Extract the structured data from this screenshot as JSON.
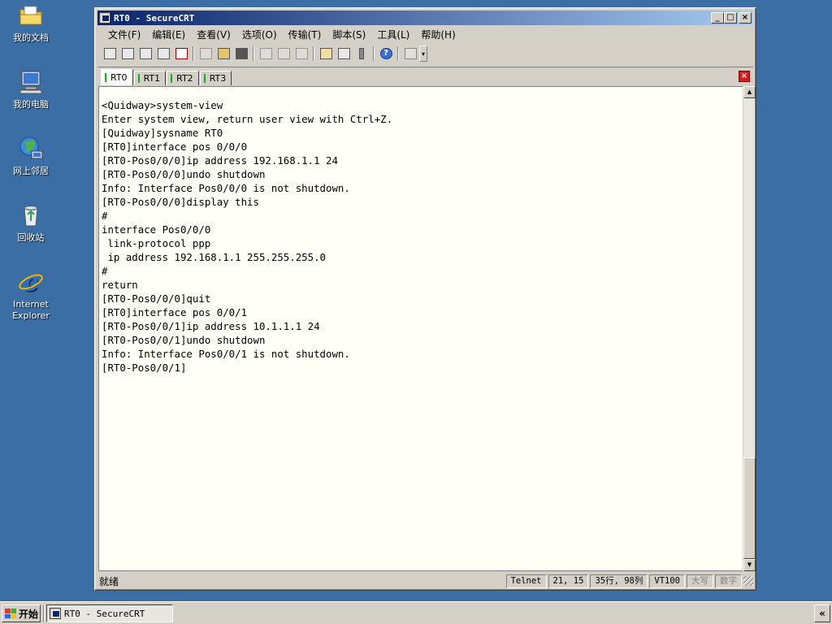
{
  "desktop": {
    "icons": [
      {
        "label": "我的文档",
        "icon": "my-documents-icon"
      },
      {
        "label": "我的电脑",
        "icon": "my-computer-icon"
      },
      {
        "label": "网上邻居",
        "icon": "network-places-icon"
      },
      {
        "label": "回收站",
        "icon": "recycle-bin-icon"
      },
      {
        "label": "Internet Explorer",
        "icon": "internet-explorer-icon"
      }
    ]
  },
  "window": {
    "title": "RT0 - SecureCRT",
    "controls": {
      "minimize": "_",
      "maximize": "□",
      "close": "×"
    }
  },
  "menu": [
    "文件(F)",
    "编辑(E)",
    "查看(V)",
    "选项(O)",
    "传输(T)",
    "脚本(S)",
    "工具(L)",
    "帮助(H)"
  ],
  "toolbar": {
    "icons": [
      "connect-icon",
      "quick-connect-icon",
      "connect-tab-icon",
      "reconnect-icon",
      "disconnect-icon",
      "copy-icon",
      "paste-icon",
      "find-icon",
      "print-setup-icon",
      "print-icon",
      "print-selection-icon",
      "session-options-icon",
      "global-options-icon",
      "keymap-icon",
      "help-icon",
      "sftp-icon"
    ],
    "help_glyph": "?",
    "more_glyph": "▾"
  },
  "tabs": [
    {
      "label": "RT0",
      "active": true
    },
    {
      "label": "RT1",
      "active": false
    },
    {
      "label": "RT2",
      "active": false
    },
    {
      "label": "RT3",
      "active": false
    }
  ],
  "tab_close": "×",
  "terminal": {
    "lines": [
      "<Quidway>system-view",
      "Enter system view, return user view with Ctrl+Z.",
      "[Quidway]sysname RT0",
      "[RT0]interface pos 0/0/0",
      "[RT0-Pos0/0/0]ip address 192.168.1.1 24",
      "[RT0-Pos0/0/0]undo shutdown",
      "Info: Interface Pos0/0/0 is not shutdown.",
      "[RT0-Pos0/0/0]display this",
      "#",
      "interface Pos0/0/0",
      " link-protocol ppp",
      " ip address 192.168.1.1 255.255.255.0",
      "#",
      "return",
      "[RT0-Pos0/0/0]quit",
      "[RT0]interface pos 0/0/1",
      "[RT0-Pos0/0/1]ip address 10.1.1.1 24",
      "[RT0-Pos0/0/1]undo shutdown",
      "Info: Interface Pos0/0/1 is not shutdown.",
      "[RT0-Pos0/0/1]"
    ]
  },
  "scrollbar": {
    "up": "▲",
    "down": "▼"
  },
  "status": {
    "ready": "就绪",
    "protocol": "Telnet",
    "cursor": "21,  15",
    "size": "35行, 98列",
    "emulation": "VT100",
    "caps": "大写",
    "num": "数字"
  },
  "taskbar": {
    "start": "开始",
    "task_title": "RT0 - SecureCRT",
    "tray_toggle": "«"
  },
  "colors": {
    "desktop": "#3a6ea5",
    "title_gradient_start": "#0a246a",
    "title_gradient_end": "#a6caf0",
    "terminal_bg": "#fffff8",
    "tab_marker": "#10b010",
    "tab_close": "#d81b1b"
  }
}
